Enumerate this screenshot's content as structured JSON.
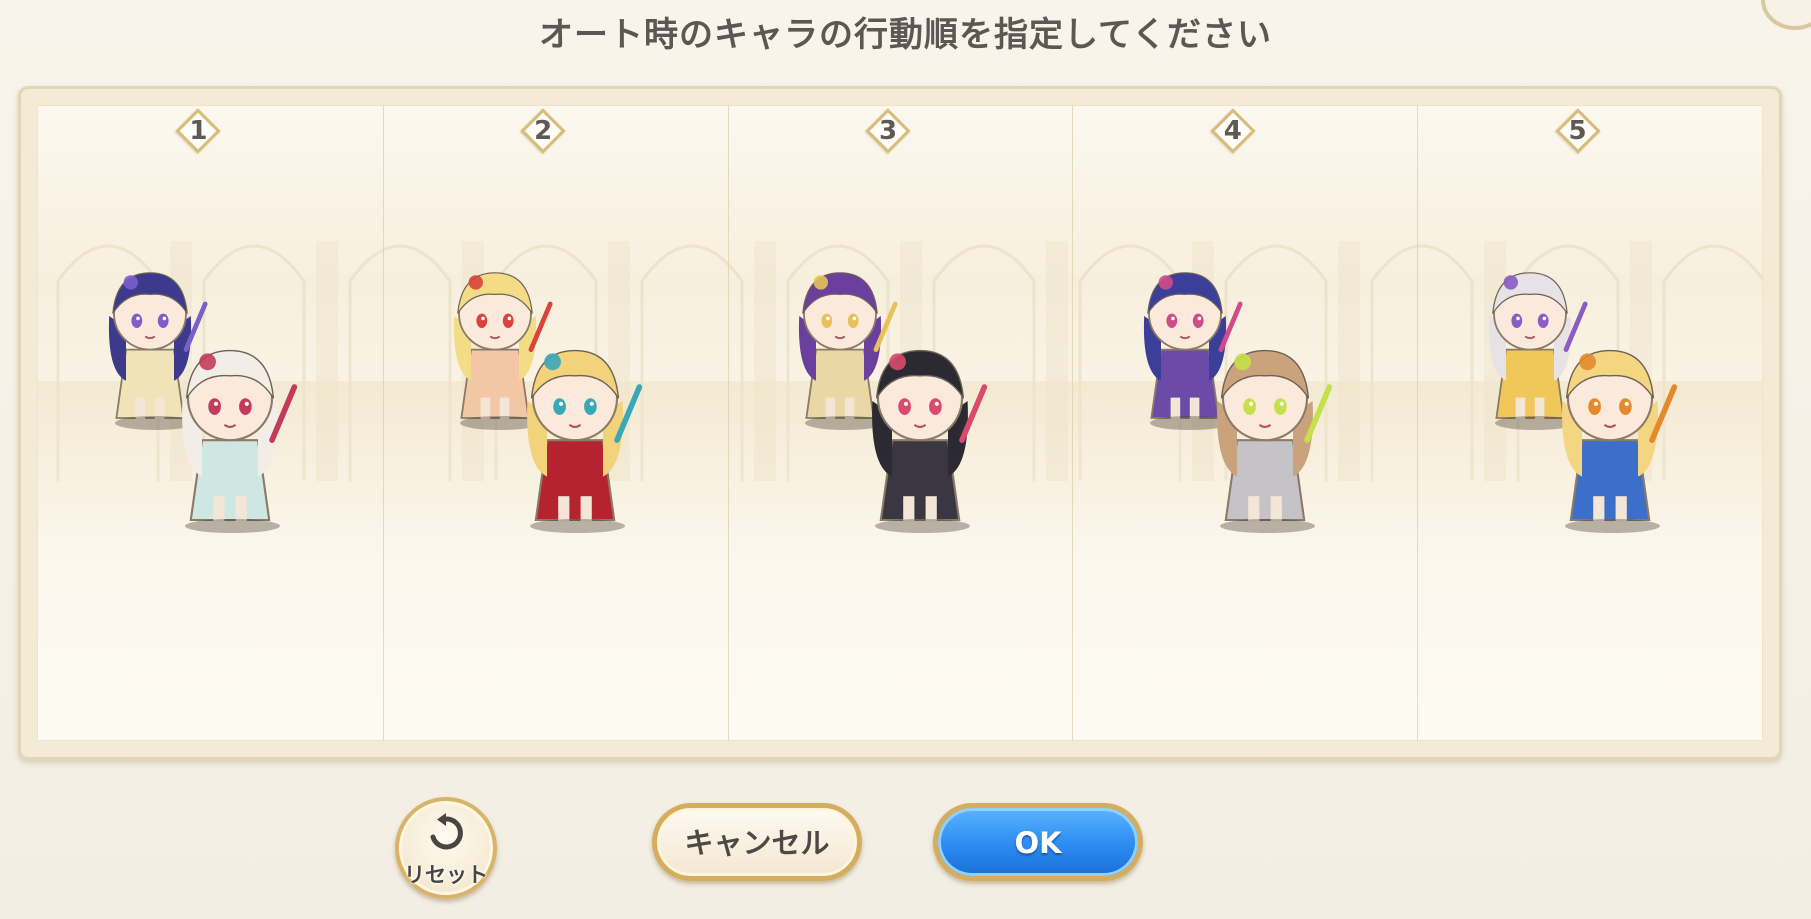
{
  "dialog": {
    "title": "オート時のキャラの行動順を指定してください"
  },
  "slots": [
    {
      "order": "1",
      "characters": [
        {
          "name": "cat-eared-staff-mage",
          "hair": "#3d3a8e",
          "outfit": "#f1e3b8",
          "accent": "#7a5fc9"
        },
        {
          "name": "white-haired-bride-on-horse",
          "hair": "#f2ede6",
          "outfit": "#cfe7e2",
          "accent": "#c23b5a"
        }
      ]
    },
    {
      "order": "2",
      "characters": [
        {
          "name": "blonde-flower-swordswoman",
          "hair": "#f4dc86",
          "outfit": "#f3c7a6",
          "accent": "#d8433b"
        },
        {
          "name": "santa-princess-knight",
          "hair": "#f2d27a",
          "outfit": "#b5232e",
          "accent": "#3aa7b8"
        }
      ]
    },
    {
      "order": "3",
      "characters": [
        {
          "name": "purple-haired-haloed-priestess",
          "hair": "#6b3f9e",
          "outfit": "#e9d7a6",
          "accent": "#e7c25a"
        },
        {
          "name": "black-white-haired-guitarist",
          "hair": "#2b2a33",
          "outfit": "#3a3742",
          "accent": "#d94a6b"
        }
      ]
    },
    {
      "order": "4",
      "characters": [
        {
          "name": "blue-haired-lance-girl",
          "hair": "#3b3f9a",
          "outfit": "#6b4aa8",
          "accent": "#d04b8a"
        },
        {
          "name": "brown-haired-greatsword-knight",
          "hair": "#caa27b",
          "outfit": "#c5c2c8",
          "accent": "#c4e04a"
        }
      ]
    },
    {
      "order": "5",
      "characters": [
        {
          "name": "silver-haired-naginata-maiden",
          "hair": "#e7e2e6",
          "outfit": "#f0c85a",
          "accent": "#8a5cc4"
        },
        {
          "name": "blonde-girl-riding-tiger",
          "hair": "#f3d582",
          "outfit": "#3b6fc9",
          "accent": "#e48a2a"
        }
      ]
    }
  ],
  "buttons": {
    "reset_label": "リセット",
    "cancel_label": "キャンセル",
    "ok_label": "OK"
  },
  "colors": {
    "parchment": "#f4ebd6",
    "badge_border": "#d9bb7a",
    "ok_blue": "#2f8ff2",
    "button_gold": "#d4ad5f"
  },
  "icons": {
    "reset": "rotate-ccw-icon"
  }
}
